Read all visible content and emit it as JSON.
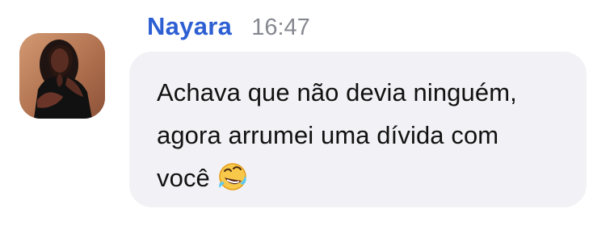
{
  "message": {
    "sender_name": "Nayara",
    "timestamp": "16:47",
    "lines": [
      "Achava que não devia ninguém,",
      "agora arrumei uma dívida com",
      "você"
    ],
    "emoji": "rolling-on-the-floor-laughing-emoji"
  },
  "colors": {
    "sender_name": "#2d5fd3",
    "timestamp": "#85888f",
    "bubble_background": "#f2f2f6",
    "message_text": "#111111"
  }
}
